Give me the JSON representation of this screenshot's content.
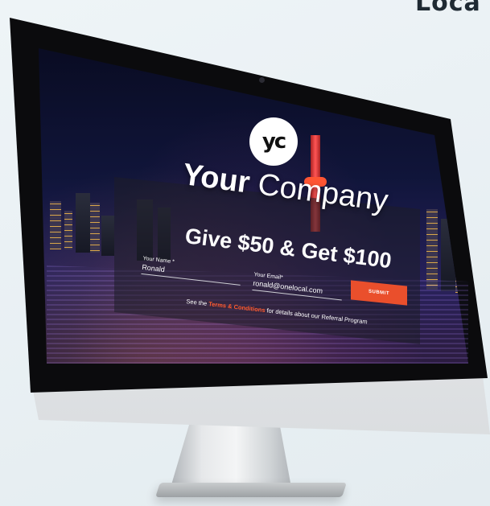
{
  "page": {
    "corner_text": "Loca"
  },
  "colors": {
    "accent": "#ea4f2c",
    "link": "#ff5a2e",
    "background": "#eef4f7"
  },
  "landing": {
    "logo_icon": "yc-logo-icon",
    "logo_text": "yc",
    "company_bold": "Your",
    "company_rest": " Company",
    "headline": "Give $50 & Get $100",
    "name_label": "Your Name *",
    "name_value": "Ronald",
    "email_label": "Your Email*",
    "email_value": "ronald@onelocal.com",
    "submit_label": "SUBMIT",
    "terms_prefix": "See the ",
    "terms_link": "Terms & Conditions",
    "terms_suffix": " for details about our Referral Program"
  }
}
